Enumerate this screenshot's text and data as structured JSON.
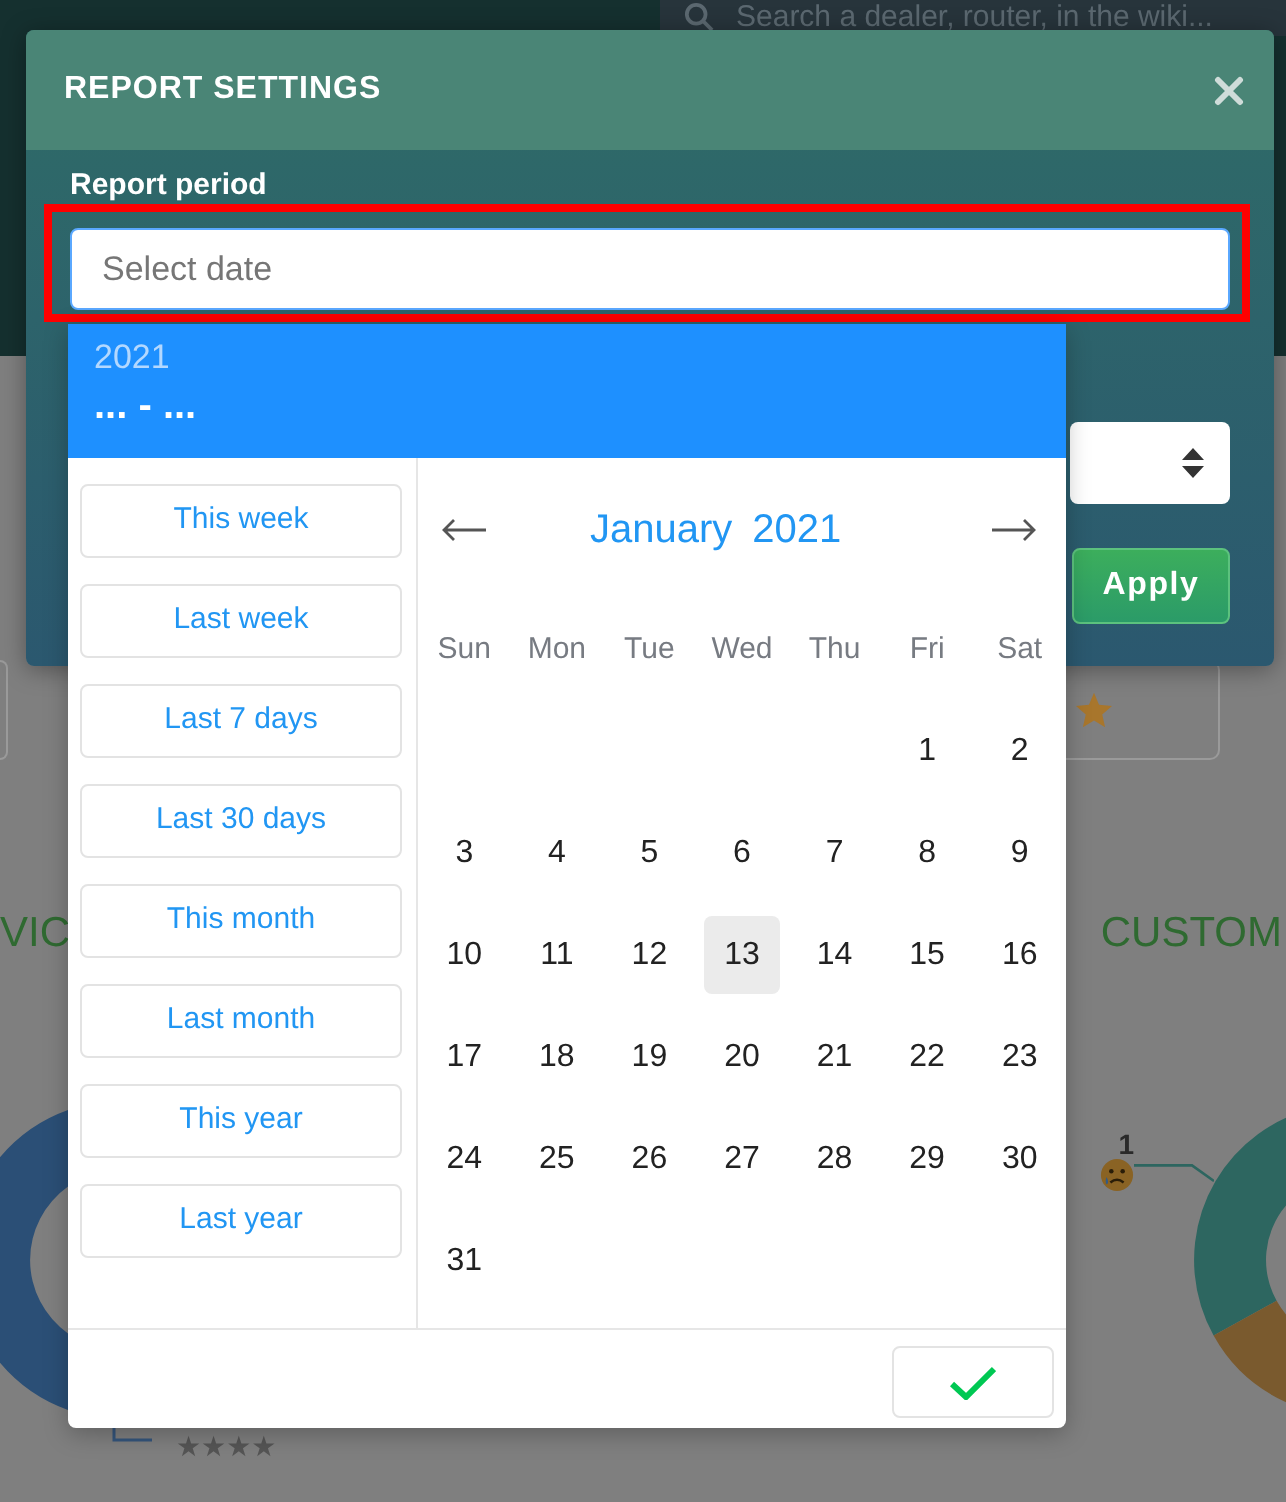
{
  "app_header": {
    "search": {
      "placeholder": "Search a dealer, router, in the wiki..."
    }
  },
  "dashboard": {
    "section_titles": [
      "VIC",
      "CUSTOM"
    ],
    "customer_chart": {
      "label": "1"
    },
    "rating_chart": {
      "label": "★★★★"
    }
  },
  "modal": {
    "title": "REPORT SETTINGS",
    "report_period": {
      "label": "Report period",
      "placeholder": "Select date"
    },
    "apply_button": "Apply"
  },
  "datepicker": {
    "year": "2021",
    "range": "... - ...",
    "presets": [
      "This week",
      "Last week",
      "Last 7 days",
      "Last 30 days",
      "This month",
      "Last month",
      "This year",
      "Last year"
    ],
    "month": "January",
    "month_year": "2021",
    "weekdays": [
      "Sun",
      "Mon",
      "Tue",
      "Wed",
      "Thu",
      "Fri",
      "Sat"
    ],
    "weeks": [
      [
        {
          "label": "1",
          "today": false
        },
        {
          "label": "2",
          "today": false
        }
      ],
      [
        {
          "label": "3",
          "today": false
        },
        {
          "label": "4",
          "today": false
        },
        {
          "label": "5",
          "today": false
        },
        {
          "label": "6",
          "today": false
        },
        {
          "label": "7",
          "today": false
        },
        {
          "label": "8",
          "today": false
        },
        {
          "label": "9",
          "today": false
        }
      ],
      [
        {
          "label": "10",
          "today": false
        },
        {
          "label": "11",
          "today": false
        },
        {
          "label": "12",
          "today": false
        },
        {
          "label": "13",
          "today": true
        },
        {
          "label": "14",
          "today": false
        },
        {
          "label": "15",
          "today": false
        },
        {
          "label": "16",
          "today": false
        }
      ],
      [
        {
          "label": "17",
          "today": false
        },
        {
          "label": "18",
          "today": false
        },
        {
          "label": "19",
          "today": false
        },
        {
          "label": "20",
          "today": false
        },
        {
          "label": "21",
          "today": false
        },
        {
          "label": "22",
          "today": false
        },
        {
          "label": "23",
          "today": false
        }
      ],
      [
        {
          "label": "24",
          "today": false
        },
        {
          "label": "25",
          "today": false
        },
        {
          "label": "26",
          "today": false
        },
        {
          "label": "27",
          "today": false
        },
        {
          "label": "28",
          "today": false
        },
        {
          "label": "29",
          "today": false
        },
        {
          "label": "30",
          "today": false
        }
      ],
      [
        {
          "label": "31",
          "today": false
        }
      ]
    ]
  }
}
